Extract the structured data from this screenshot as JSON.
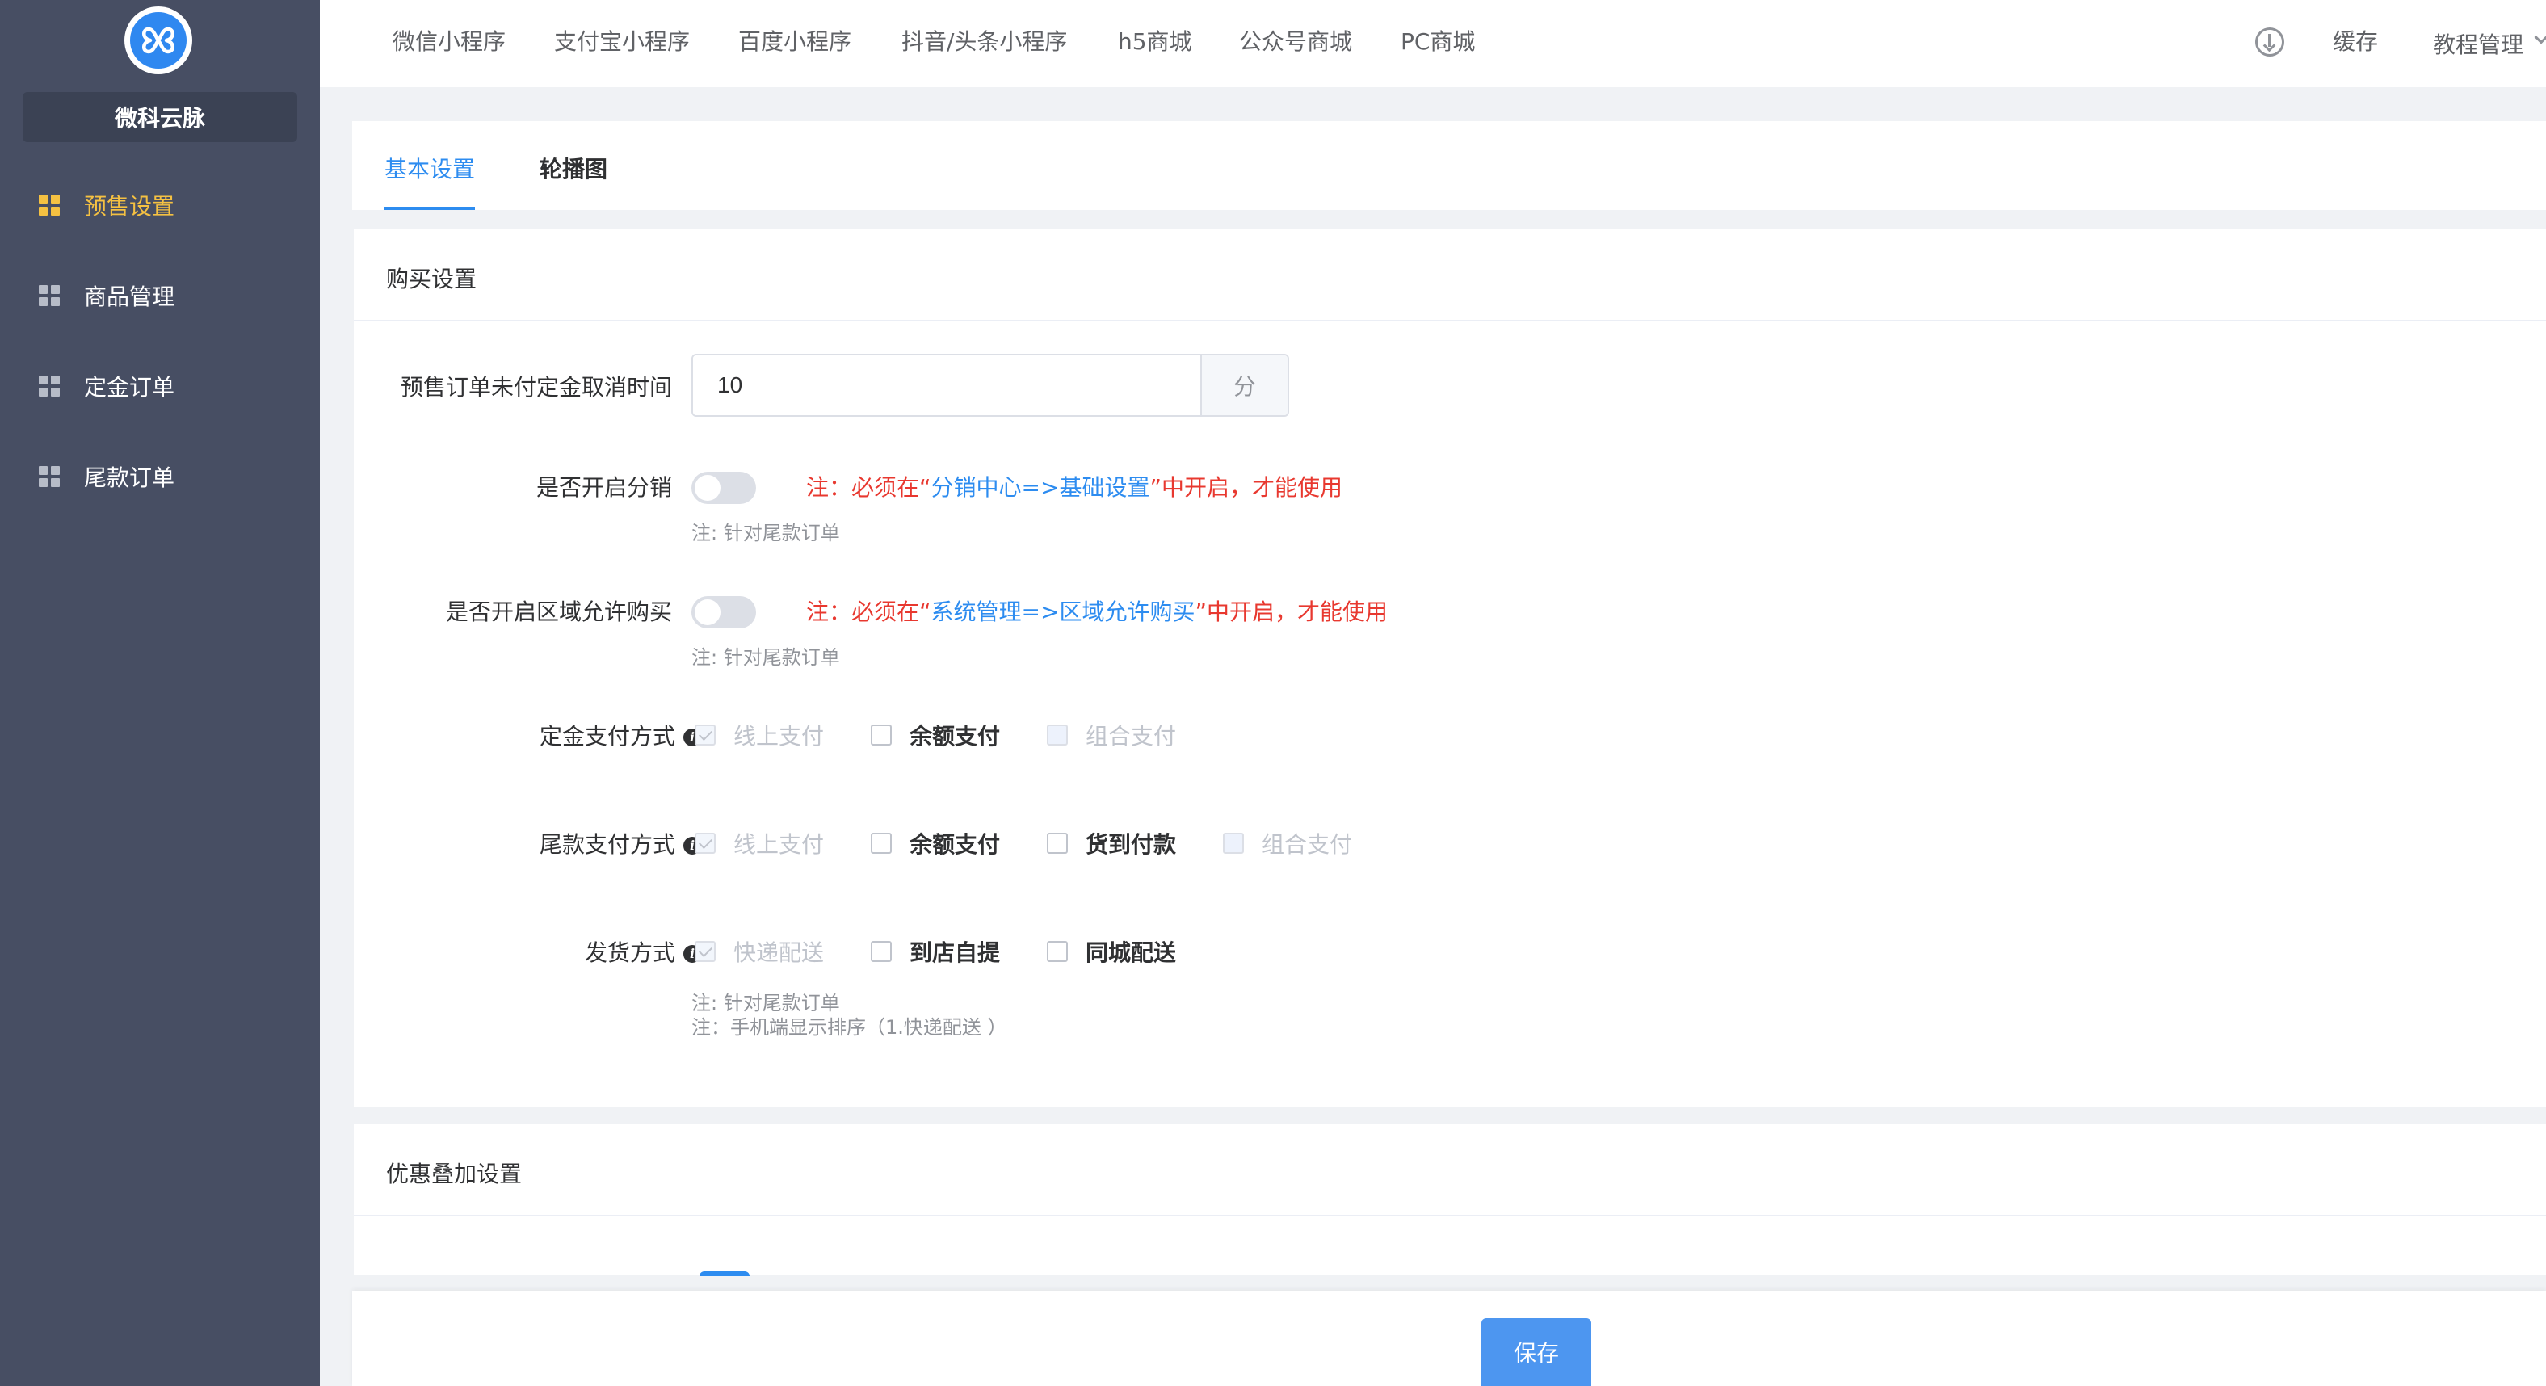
{
  "app": {
    "brand": "微科云脉",
    "logo_icon": "logo-icon"
  },
  "sidebar": {
    "items": [
      {
        "label": "预售设置",
        "active": true
      },
      {
        "label": "商品管理",
        "active": false
      },
      {
        "label": "定金订单",
        "active": false
      },
      {
        "label": "尾款订单",
        "active": false
      }
    ]
  },
  "topnav": {
    "links": [
      "微信小程序",
      "支付宝小程序",
      "百度小程序",
      "抖音/头条小程序",
      "h5商城",
      "公众号商城",
      "PC商城"
    ],
    "download_icon": "download-icon",
    "cache": "缓存",
    "menu": "教程管理"
  },
  "tabs": [
    {
      "label": "基本设置",
      "active": true
    },
    {
      "label": "轮播图",
      "active": false
    }
  ],
  "purchase": {
    "title": "购买设置",
    "cancel_time": {
      "label": "预售订单未付定金取消时间",
      "value": "10",
      "unit": "分"
    },
    "distribution": {
      "label": "是否开启分销",
      "note_prefix": "注：必须在“",
      "note_link": "分销中心=>基础设置",
      "note_suffix": "”中开启，才能使用",
      "sub_note": "注: 针对尾款订单"
    },
    "region": {
      "label": "是否开启区域允许购买",
      "note_prefix": "注：必须在“",
      "note_link": "系统管理=>区域允许购买",
      "note_suffix": "”中开启，才能使用",
      "sub_note": "注: 针对尾款订单"
    },
    "deposit_payment": {
      "label": "定金支付方式",
      "options": [
        "线上支付",
        "余额支付",
        "组合支付"
      ]
    },
    "final_payment": {
      "label": "尾款支付方式",
      "options": [
        "线上支付",
        "余额支付",
        "货到付款",
        "组合支付"
      ]
    },
    "delivery": {
      "label": "发货方式",
      "options": [
        "快递配送",
        "到店自提",
        "同城配送"
      ],
      "note1": "注: 针对尾款订单",
      "note2": "注：手机端显示排序（1.快递配送 ）"
    }
  },
  "discount": {
    "title": "优惠叠加设置"
  },
  "footer": {
    "save": "保存"
  }
}
